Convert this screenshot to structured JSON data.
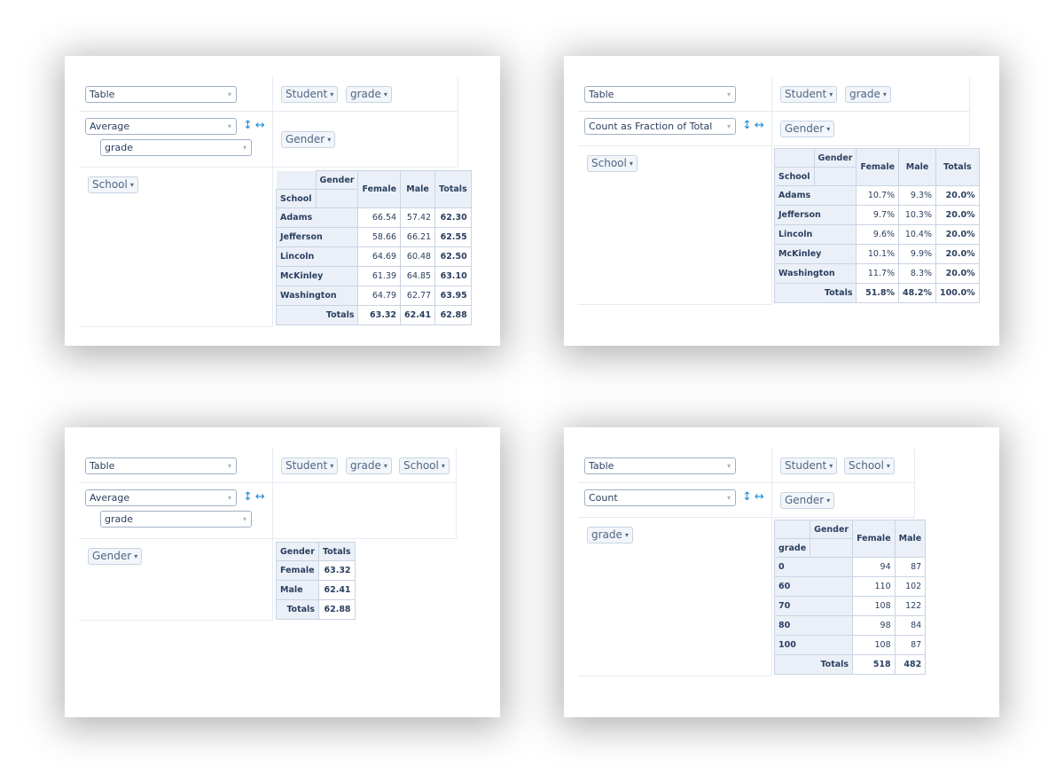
{
  "panels": [
    {
      "renderer": "Table",
      "aggregator": "Average",
      "attribute": "grade",
      "unused_attrs": [
        "Student",
        "grade"
      ],
      "col_attrs": [
        "Gender"
      ],
      "row_attrs": [
        "School"
      ],
      "table": {
        "col_attr": "Gender",
        "row_attr": "School",
        "col_headers": [
          "Female",
          "Male"
        ],
        "totals_label": "Totals",
        "rows": [
          {
            "label": "Adams",
            "values": [
              "66.54",
              "57.42"
            ],
            "total": "62.30"
          },
          {
            "label": "Jefferson",
            "values": [
              "58.66",
              "66.21"
            ],
            "total": "62.55"
          },
          {
            "label": "Lincoln",
            "values": [
              "64.69",
              "60.48"
            ],
            "total": "62.50"
          },
          {
            "label": "McKinley",
            "values": [
              "61.39",
              "64.85"
            ],
            "total": "63.10"
          },
          {
            "label": "Washington",
            "values": [
              "64.79",
              "62.77"
            ],
            "total": "63.95"
          }
        ],
        "totals_row": {
          "label": "Totals",
          "values": [
            "63.32",
            "62.41"
          ],
          "total": "62.88"
        }
      }
    },
    {
      "renderer": "Table",
      "aggregator": "Count as Fraction of Total",
      "unused_attrs": [
        "Student",
        "grade"
      ],
      "col_attrs": [
        "Gender"
      ],
      "row_attrs": [
        "School"
      ],
      "table": {
        "col_attr": "Gender",
        "row_attr": "School",
        "col_headers": [
          "Female",
          "Male"
        ],
        "totals_label": "Totals",
        "rows": [
          {
            "label": "Adams",
            "values": [
              "10.7%",
              "9.3%"
            ],
            "total": "20.0%"
          },
          {
            "label": "Jefferson",
            "values": [
              "9.7%",
              "10.3%"
            ],
            "total": "20.0%"
          },
          {
            "label": "Lincoln",
            "values": [
              "9.6%",
              "10.4%"
            ],
            "total": "20.0%"
          },
          {
            "label": "McKinley",
            "values": [
              "10.1%",
              "9.9%"
            ],
            "total": "20.0%"
          },
          {
            "label": "Washington",
            "values": [
              "11.7%",
              "8.3%"
            ],
            "total": "20.0%"
          }
        ],
        "totals_row": {
          "label": "Totals",
          "values": [
            "51.8%",
            "48.2%"
          ],
          "total": "100.0%"
        }
      }
    },
    {
      "renderer": "Table",
      "aggregator": "Average",
      "attribute": "grade",
      "unused_attrs": [
        "Student",
        "grade",
        "School"
      ],
      "col_attrs": [],
      "row_attrs": [
        "Gender"
      ],
      "table": {
        "row_attr": "Gender",
        "totals_label": "Totals",
        "rows": [
          {
            "label": "Female",
            "total": "63.32"
          },
          {
            "label": "Male",
            "total": "62.41"
          }
        ],
        "totals_row": {
          "label": "Totals",
          "total": "62.88"
        }
      }
    },
    {
      "renderer": "Table",
      "aggregator": "Count",
      "unused_attrs": [
        "Student",
        "School"
      ],
      "col_attrs": [
        "Gender"
      ],
      "row_attrs": [
        "grade"
      ],
      "table": {
        "col_attr": "Gender",
        "row_attr": "grade",
        "col_headers": [
          "Female",
          "Male"
        ],
        "rows": [
          {
            "label": "0",
            "values": [
              "94",
              "87"
            ]
          },
          {
            "label": "60",
            "values": [
              "110",
              "102"
            ]
          },
          {
            "label": "70",
            "values": [
              "108",
              "122"
            ]
          },
          {
            "label": "80",
            "values": [
              "98",
              "84"
            ]
          },
          {
            "label": "100",
            "values": [
              "108",
              "87"
            ]
          }
        ],
        "totals_row": {
          "label": "Totals",
          "values": [
            "518",
            "482"
          ]
        }
      }
    }
  ],
  "icons": {
    "caret": "▾",
    "swap_rows": "↕",
    "swap_cols": "↔"
  }
}
